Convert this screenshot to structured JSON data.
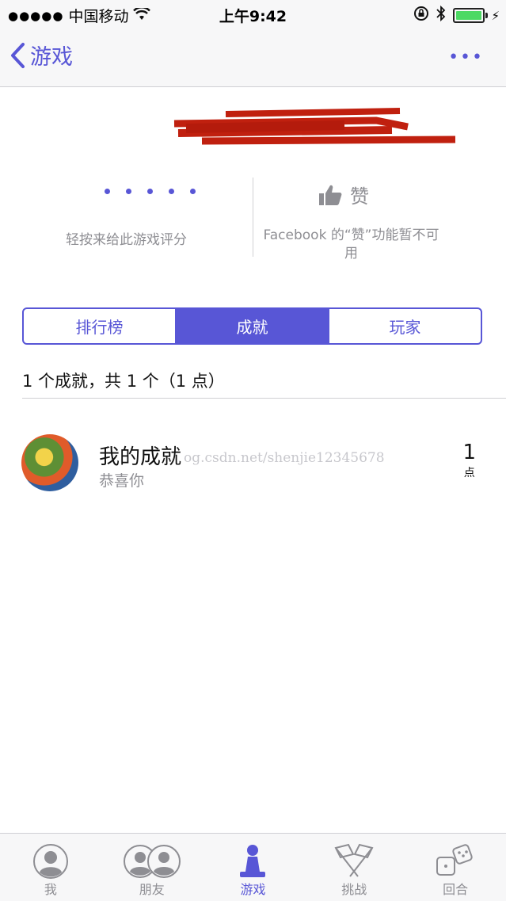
{
  "status_bar": {
    "carrier": "中国移动",
    "time": "上午9:42"
  },
  "nav": {
    "back_label": "游戏",
    "more_label": "•••"
  },
  "rating": {
    "label": "轻按来给此游戏评分"
  },
  "like": {
    "label": "赞",
    "note": "Facebook 的“赞”功能暂不可用"
  },
  "segments": [
    {
      "label": "排行榜",
      "active": false
    },
    {
      "label": "成就",
      "active": true
    },
    {
      "label": "玩家",
      "active": false
    }
  ],
  "summary": "1 个成就，共 1 个（1 点）",
  "achievements": [
    {
      "title": "我的成就",
      "subtitle": "恭喜你",
      "points": "1",
      "points_unit": "点"
    }
  ],
  "watermark": "og.csdn.net/shenjie12345678",
  "tabbar": {
    "items": [
      {
        "label": "我",
        "icon": "person-icon"
      },
      {
        "label": "朋友",
        "icon": "friends-icon"
      },
      {
        "label": "游戏",
        "icon": "game-piece-icon",
        "active": true
      },
      {
        "label": "挑战",
        "icon": "flags-icon"
      },
      {
        "label": "回合",
        "icon": "dice-icon"
      }
    ]
  },
  "colors": {
    "accent": "#5856d6",
    "gray": "#8e8e93",
    "battery": "#4cd964"
  }
}
